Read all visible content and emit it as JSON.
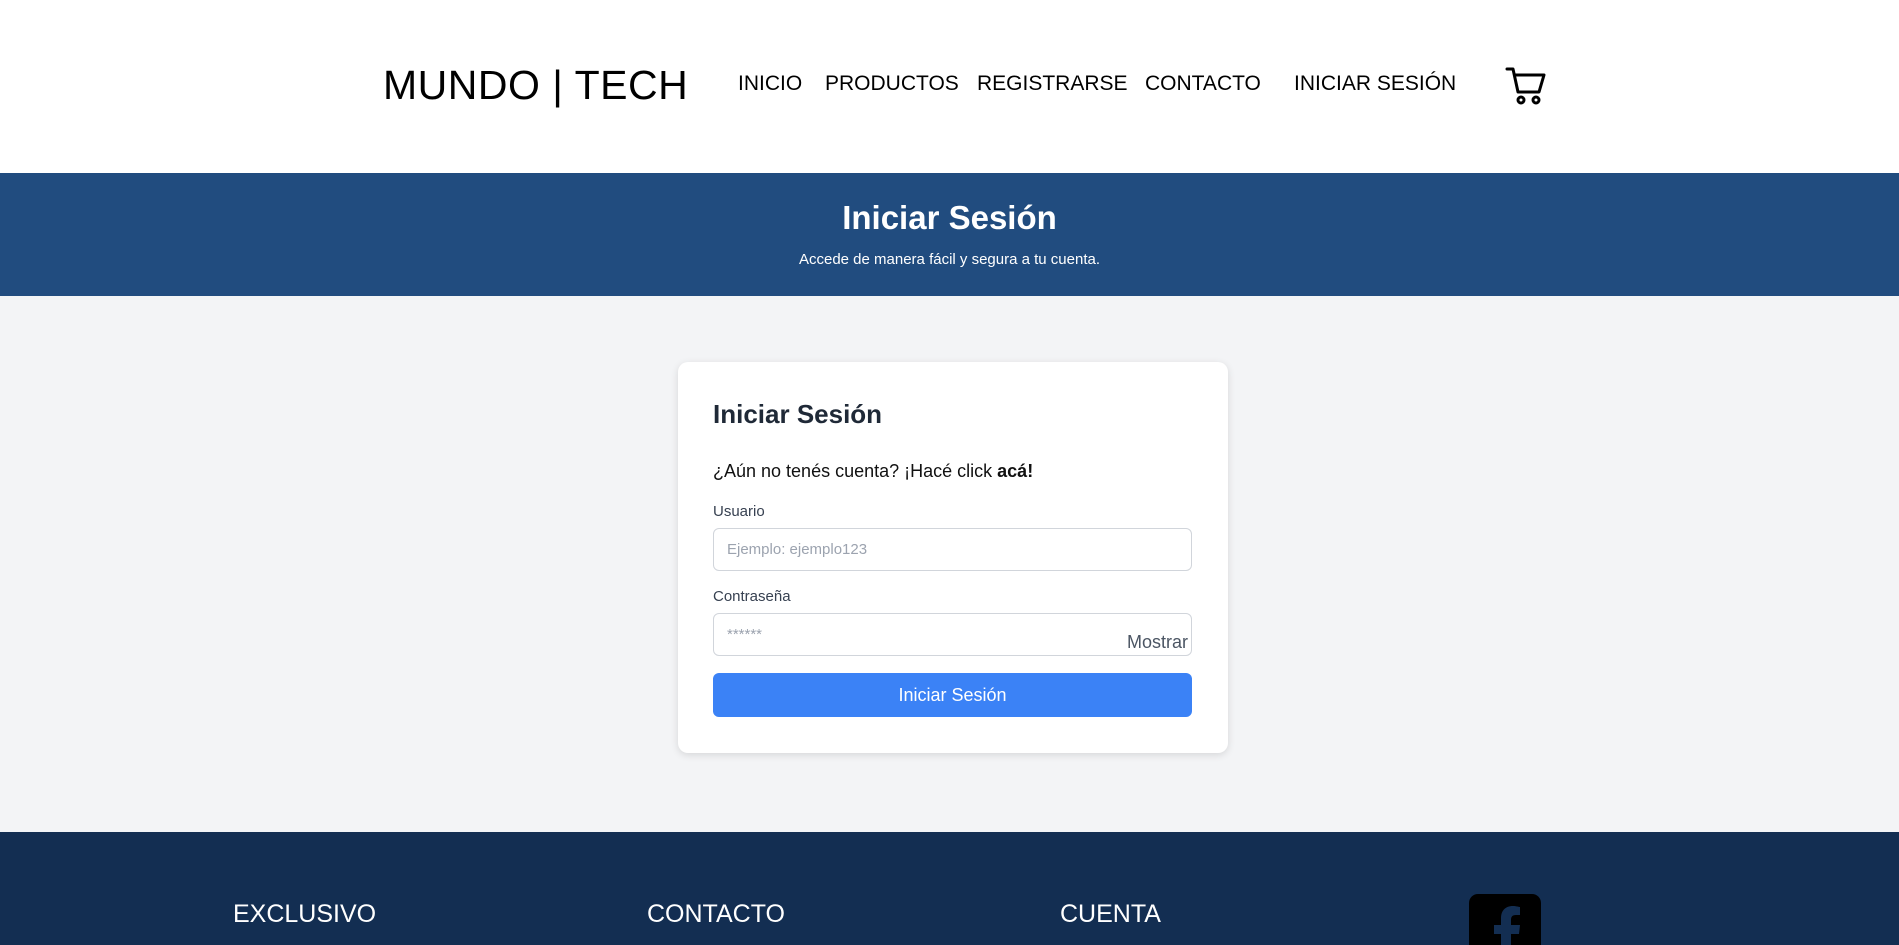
{
  "header": {
    "brand": "MUNDO | TECH",
    "nav": [
      {
        "label": "INICIO"
      },
      {
        "label": "PRODUCTOS"
      },
      {
        "label": "REGISTRARSE"
      },
      {
        "label": "CONTACTO"
      },
      {
        "label": "INICIAR SESIÓN"
      }
    ],
    "cart_icon": "shopping-cart-icon"
  },
  "banner": {
    "title": "Iniciar Sesión",
    "subtitle": "Accede de manera fácil y segura a tu cuenta."
  },
  "login_card": {
    "title": "Iniciar Sesión",
    "prompt_text": "¿Aún no tenés cuenta? ¡Hacé click ",
    "prompt_link": "acá!",
    "username": {
      "label": "Usuario",
      "placeholder": "Ejemplo: ejemplo123",
      "value": ""
    },
    "password": {
      "label": "Contraseña",
      "placeholder": "******",
      "value": "",
      "toggle_label": "Mostrar"
    },
    "submit_label": "Iniciar Sesión"
  },
  "footer": {
    "columns": [
      {
        "heading": "EXCLUSIVO"
      },
      {
        "heading": "CONTACTO"
      },
      {
        "heading": "CUENTA"
      }
    ],
    "social_icon": "facebook-icon"
  },
  "colors": {
    "banner_bg": "#214c7f",
    "footer_bg": "#132e52",
    "primary_button": "#3b82f6",
    "page_bg": "#f3f4f6"
  }
}
